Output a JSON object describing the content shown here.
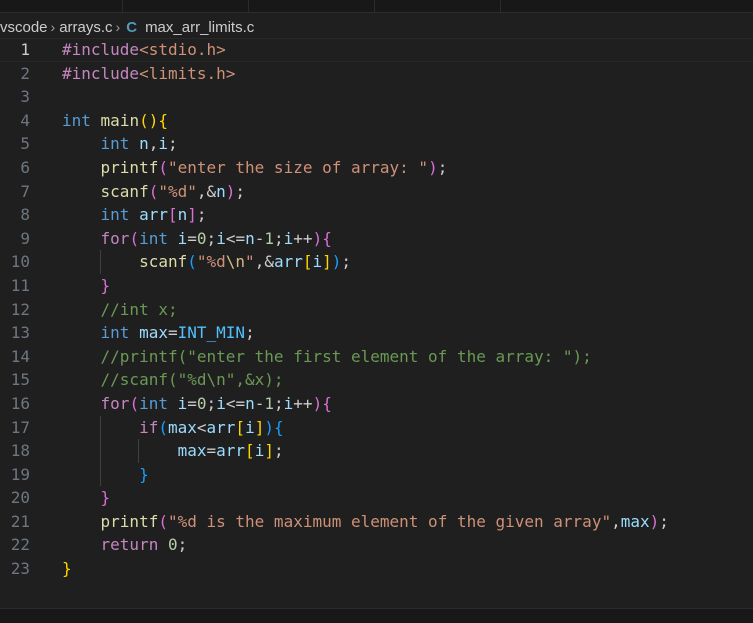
{
  "breadcrumb": {
    "items": [
      "vscode",
      "arrays.c",
      "max_arr_limits.c"
    ],
    "file_icon": "C"
  },
  "active_line": 1,
  "code": [
    [
      [
        "#include",
        "pp"
      ],
      [
        "<stdio.h>",
        "inc"
      ]
    ],
    [
      [
        "#include",
        "pp"
      ],
      [
        "<limits.h>",
        "inc"
      ]
    ],
    [],
    [
      [
        "int",
        "kw"
      ],
      [
        " ",
        "p"
      ],
      [
        "main",
        "fn"
      ],
      [
        "()",
        "b1"
      ],
      [
        "{",
        "b1"
      ]
    ],
    [
      [
        "    ",
        "p"
      ],
      [
        "int",
        "kw"
      ],
      [
        " ",
        "p"
      ],
      [
        "n",
        "var"
      ],
      [
        ",",
        "p"
      ],
      [
        "i",
        "var"
      ],
      [
        ";",
        "p"
      ]
    ],
    [
      [
        "    ",
        "p"
      ],
      [
        "printf",
        "fn"
      ],
      [
        "(",
        "b2"
      ],
      [
        "\"enter the size of array: \"",
        "str"
      ],
      [
        ")",
        "b2"
      ],
      [
        ";",
        "p"
      ]
    ],
    [
      [
        "    ",
        "p"
      ],
      [
        "scanf",
        "fn"
      ],
      [
        "(",
        "b2"
      ],
      [
        "\"%d\"",
        "str"
      ],
      [
        ",&",
        "p"
      ],
      [
        "n",
        "var"
      ],
      [
        ")",
        "b2"
      ],
      [
        ";",
        "p"
      ]
    ],
    [
      [
        "    ",
        "p"
      ],
      [
        "int",
        "kw"
      ],
      [
        " ",
        "p"
      ],
      [
        "arr",
        "var"
      ],
      [
        "[",
        "b2"
      ],
      [
        "n",
        "var"
      ],
      [
        "]",
        "b2"
      ],
      [
        ";",
        "p"
      ]
    ],
    [
      [
        "    ",
        "p"
      ],
      [
        "for",
        "pp"
      ],
      [
        "(",
        "b2"
      ],
      [
        "int",
        "kw"
      ],
      [
        " ",
        "p"
      ],
      [
        "i",
        "var"
      ],
      [
        "=",
        "p"
      ],
      [
        "0",
        "num"
      ],
      [
        ";",
        "p"
      ],
      [
        "i",
        "var"
      ],
      [
        "<=",
        "p"
      ],
      [
        "n",
        "var"
      ],
      [
        "-",
        "p"
      ],
      [
        "1",
        "num"
      ],
      [
        ";",
        "p"
      ],
      [
        "i",
        "var"
      ],
      [
        "++",
        "p"
      ],
      [
        ")",
        "b2"
      ],
      [
        "{",
        "b2"
      ]
    ],
    [
      [
        "        ",
        "p"
      ],
      [
        "scanf",
        "fn"
      ],
      [
        "(",
        "b3"
      ],
      [
        "\"%d",
        "str"
      ],
      [
        "\\n",
        "esc"
      ],
      [
        "\"",
        "str"
      ],
      [
        ",&",
        "p"
      ],
      [
        "arr",
        "var"
      ],
      [
        "[",
        "b1"
      ],
      [
        "i",
        "var"
      ],
      [
        "]",
        "b1"
      ],
      [
        ")",
        "b3"
      ],
      [
        ";",
        "p"
      ]
    ],
    [
      [
        "    ",
        "p"
      ],
      [
        "}",
        "b2"
      ]
    ],
    [
      [
        "    ",
        "p"
      ],
      [
        "//int x;",
        "cmt"
      ]
    ],
    [
      [
        "    ",
        "p"
      ],
      [
        "int",
        "kw"
      ],
      [
        " ",
        "p"
      ],
      [
        "max",
        "var"
      ],
      [
        "=",
        "p"
      ],
      [
        "INT_MIN",
        "const"
      ],
      [
        ";",
        "p"
      ]
    ],
    [
      [
        "    ",
        "p"
      ],
      [
        "//printf(\"enter the first element of the array: \");",
        "cmt"
      ]
    ],
    [
      [
        "    ",
        "p"
      ],
      [
        "//scanf(\"%d\\n\",&x);",
        "cmt"
      ]
    ],
    [
      [
        "    ",
        "p"
      ],
      [
        "for",
        "pp"
      ],
      [
        "(",
        "b2"
      ],
      [
        "int",
        "kw"
      ],
      [
        " ",
        "p"
      ],
      [
        "i",
        "var"
      ],
      [
        "=",
        "p"
      ],
      [
        "0",
        "num"
      ],
      [
        ";",
        "p"
      ],
      [
        "i",
        "var"
      ],
      [
        "<=",
        "p"
      ],
      [
        "n",
        "var"
      ],
      [
        "-",
        "p"
      ],
      [
        "1",
        "num"
      ],
      [
        ";",
        "p"
      ],
      [
        "i",
        "var"
      ],
      [
        "++",
        "p"
      ],
      [
        ")",
        "b2"
      ],
      [
        "{",
        "b2"
      ]
    ],
    [
      [
        "        ",
        "p"
      ],
      [
        "if",
        "pp"
      ],
      [
        "(",
        "b3"
      ],
      [
        "max",
        "var"
      ],
      [
        "<",
        "p"
      ],
      [
        "arr",
        "var"
      ],
      [
        "[",
        "b1"
      ],
      [
        "i",
        "var"
      ],
      [
        "]",
        "b1"
      ],
      [
        ")",
        "b3"
      ],
      [
        "{",
        "b3"
      ]
    ],
    [
      [
        "            ",
        "p"
      ],
      [
        "max",
        "var"
      ],
      [
        "=",
        "p"
      ],
      [
        "arr",
        "var"
      ],
      [
        "[",
        "b1"
      ],
      [
        "i",
        "var"
      ],
      [
        "]",
        "b1"
      ],
      [
        ";",
        "p"
      ]
    ],
    [
      [
        "        ",
        "p"
      ],
      [
        "}",
        "b3"
      ]
    ],
    [
      [
        "    ",
        "p"
      ],
      [
        "}",
        "b2"
      ]
    ],
    [
      [
        "    ",
        "p"
      ],
      [
        "printf",
        "fn"
      ],
      [
        "(",
        "b2"
      ],
      [
        "\"%d is the maximum element of the given array\"",
        "str"
      ],
      [
        ",",
        "p"
      ],
      [
        "max",
        "var"
      ],
      [
        ")",
        "b2"
      ],
      [
        ";",
        "p"
      ]
    ],
    [
      [
        "    ",
        "p"
      ],
      [
        "return",
        "pp"
      ],
      [
        " ",
        "p"
      ],
      [
        "0",
        "num"
      ],
      [
        ";",
        "p"
      ]
    ],
    [
      [
        "}",
        "b1"
      ]
    ]
  ],
  "colors": {
    "background": "#1f1f1f",
    "keyword": "#569cd6",
    "control": "#c586c0",
    "function": "#dcdcaa",
    "variable": "#9cdcfe",
    "string": "#ce9178",
    "number": "#b5cea8",
    "comment": "#6a9955",
    "constant": "#4fc1ff",
    "bracket_1": "#ffd700",
    "bracket_2": "#da70d6",
    "bracket_3": "#179fff"
  }
}
